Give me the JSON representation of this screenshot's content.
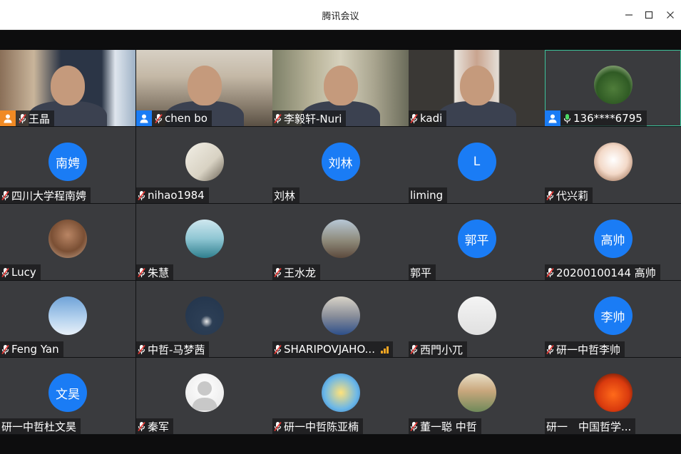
{
  "window": {
    "title": "腾讯会议"
  },
  "participants": [
    {
      "name": "王晶",
      "mic": "muted",
      "badge": "host",
      "media": "video",
      "video_scene": "bookshelf-office"
    },
    {
      "name": "chen bo",
      "mic": "muted",
      "badge": "cohost",
      "media": "video",
      "video_scene": "study-room"
    },
    {
      "name": "李毅轩-Nuri",
      "mic": "muted",
      "media": "video",
      "video_scene": "curtain-room"
    },
    {
      "name": "kadi",
      "mic": "muted",
      "media": "video",
      "video_scene": "dark-room-portrait"
    },
    {
      "name": "136****6795",
      "mic": "on",
      "badge": "cohost",
      "media": "photo",
      "avatar_theme": "forest",
      "active": true
    },
    {
      "name": "四川大学程南娉",
      "mic": "muted",
      "media": "initials",
      "initials": "南娉"
    },
    {
      "name": "nihao1984",
      "mic": "muted",
      "media": "photo",
      "avatar_theme": "calligraphy"
    },
    {
      "name": "刘林",
      "mic": "none",
      "media": "initials",
      "initials": "刘林"
    },
    {
      "name": "liming",
      "mic": "none",
      "media": "initials",
      "initials": "L"
    },
    {
      "name": "代兴莉",
      "mic": "muted",
      "media": "photo",
      "avatar_theme": "cartoon-girl"
    },
    {
      "name": "Lucy",
      "mic": "muted",
      "media": "photo",
      "avatar_theme": "portrait-woman"
    },
    {
      "name": "朱慧",
      "mic": "muted",
      "media": "photo",
      "avatar_theme": "lake"
    },
    {
      "name": "王水龙",
      "mic": "muted",
      "media": "photo",
      "avatar_theme": "mountain-portrait"
    },
    {
      "name": "郭平",
      "mic": "none",
      "media": "initials",
      "initials": "郭平"
    },
    {
      "name": "20200100144 高帅",
      "mic": "muted",
      "media": "initials",
      "initials": "高帅"
    },
    {
      "name": "Feng Yan",
      "mic": "muted",
      "media": "photo",
      "avatar_theme": "sky"
    },
    {
      "name": "中哲-马梦茜",
      "mic": "muted",
      "media": "photo",
      "avatar_theme": "night"
    },
    {
      "name": "SHARIPOVJAHO...",
      "mic": "muted",
      "media": "photo",
      "avatar_theme": "city-portrait",
      "signal": "weak"
    },
    {
      "name": "西門小兀",
      "mic": "muted",
      "media": "photo",
      "avatar_theme": "i-love-text"
    },
    {
      "name": "研一中哲李帅",
      "mic": "muted",
      "media": "initials",
      "initials": "李帅"
    },
    {
      "name": "研一中哲杜文昊",
      "mic": "none",
      "media": "initials",
      "initials": "文昊"
    },
    {
      "name": "秦军",
      "mic": "muted",
      "media": "photo",
      "avatar_theme": "default-person"
    },
    {
      "name": "研一中哲陈亚楠",
      "mic": "muted",
      "media": "photo",
      "avatar_theme": "cartoon-boy"
    },
    {
      "name": "董一聪 中哲",
      "mic": "muted",
      "media": "photo",
      "avatar_theme": "garden-portrait"
    },
    {
      "name": "研一　中国哲学...",
      "mic": "none",
      "media": "photo",
      "avatar_theme": "sunset-silhouette"
    }
  ],
  "colors": {
    "initials_bg": "#1a7cf5",
    "tile_bg": "#3a3b3e",
    "active_border": "#3cc39a",
    "host_badge": "#f08a24",
    "cohost_badge": "#1a7cf5"
  }
}
